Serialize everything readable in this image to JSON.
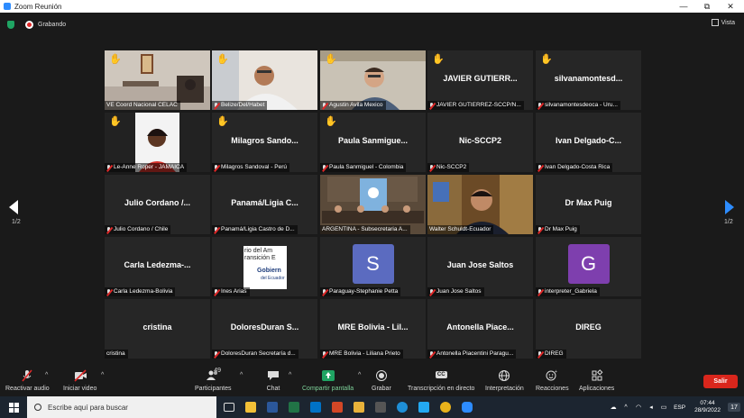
{
  "window": {
    "title": "Zoom Reunión",
    "minimize": "—",
    "restore": "⧉",
    "close": "✕"
  },
  "topbar": {
    "recording_label": "Grabando",
    "view_label": "Vista"
  },
  "gallery": {
    "page_left": "1/2",
    "page_right": "1/2",
    "tiles": [
      {
        "label": "VE Coord Nacional CELAC",
        "video": "room",
        "hand": "yellow",
        "muted": false
      },
      {
        "label": "Belize/Del/Habet",
        "video": "man-white",
        "hand": "yellow",
        "muted": true
      },
      {
        "label": "Agustin Avila Mexico",
        "video": "man-glasses",
        "hand": "yellow",
        "muted": true
      },
      {
        "label": "JAVIER GUTIERREZ-SCCP/N...",
        "big": "JAVIER GUTIERR...",
        "hand": "yellow",
        "muted": true
      },
      {
        "label": "silvanamontesdeoca - Uru...",
        "big": "silvanamontesd...",
        "hand": "yellow",
        "muted": true
      },
      {
        "label": "Le-Anne Roper - JAMAICA",
        "video": "woman",
        "hand": "dark",
        "muted": true
      },
      {
        "label": "Milagros Sandoval - Perú",
        "big": "Milagros  Sando...",
        "hand": "yellow",
        "muted": true
      },
      {
        "label": "Paula Sanmiguel - Colombia",
        "big": "Paula  Sanmigue...",
        "hand": "yellow",
        "muted": true
      },
      {
        "label": "Nic-SCCP2",
        "big": "Nic-SCCP2",
        "muted": true
      },
      {
        "label": "Ivan Delgado-Costa Rica",
        "big": "Ivan  Delgado-C...",
        "muted": true
      },
      {
        "label": "Julio Cordano / Chile",
        "big": "Julio Cordano /...",
        "muted": true
      },
      {
        "label": "Panamá/Ligia Castro de D...",
        "big": "Panamá/Ligia  C...",
        "muted": true
      },
      {
        "label": "ARGENTINA - Subsecretaria A...",
        "video": "argentina",
        "muted": false
      },
      {
        "label": "Walter Schuldt-Ecuador",
        "video": "walter",
        "muted": false,
        "active": true
      },
      {
        "label": "Dr Max Puig",
        "big": "Dr Max Puig",
        "muted": true
      },
      {
        "label": "Carla Ledezma-Bolivia",
        "big": "Carla  Ledezma-...",
        "muted": true
      },
      {
        "label": "Ines Arias",
        "video": "ines",
        "muted": true
      },
      {
        "label": "Paraguay-Stephanie Petta",
        "avatar": "S",
        "avatar_color": "#5b6bc0",
        "muted": true
      },
      {
        "label": "Juan Jose Saltos",
        "big": "Juan Jose Saltos",
        "muted": true
      },
      {
        "label": "interpreter_Gabriela",
        "avatar": "G",
        "avatar_color": "#7e3fae",
        "muted": true
      },
      {
        "label": "cristina",
        "big": "cristina",
        "muted": false
      },
      {
        "label": "DoloresDuran Secretaría d...",
        "big": "DoloresDuran  S...",
        "muted": true
      },
      {
        "label": "MRE Bolivia - Liliana Prieto",
        "big": "MRE Bolivia - Lil...",
        "muted": true
      },
      {
        "label": "Antonella Piacentini Paragu...",
        "big": "Antonella  Piace...",
        "muted": true
      },
      {
        "label": "DIREG",
        "big": "DIREG",
        "muted": true
      }
    ],
    "ines_video_text": {
      "line1": "rio del Am",
      "line2": "ransición E",
      "line3": "Gobiern",
      "line4": "del Ecuador"
    }
  },
  "toolbar": {
    "mute": "Reactivar audio",
    "video": "Iniciar video",
    "participants": "Participantes",
    "participants_count": "49",
    "chat": "Chat",
    "share": "Compartir pantalla",
    "record": "Grabar",
    "transcript": "Transcripción en directo",
    "transcript_badge": "CC",
    "interpretation": "Interpretación",
    "reactions": "Reacciones",
    "apps": "Aplicaciones",
    "leave": "Salir"
  },
  "taskbar": {
    "search_placeholder": "Escribe aquí para buscar",
    "time": "07:44",
    "date": "28/9/2022",
    "lang": "ESP",
    "notifications": "17"
  },
  "colors": {
    "accent": "#2d8cff",
    "active_outline": "#c8e34a",
    "leave": "#d9261c",
    "hand": "#f5c242"
  }
}
